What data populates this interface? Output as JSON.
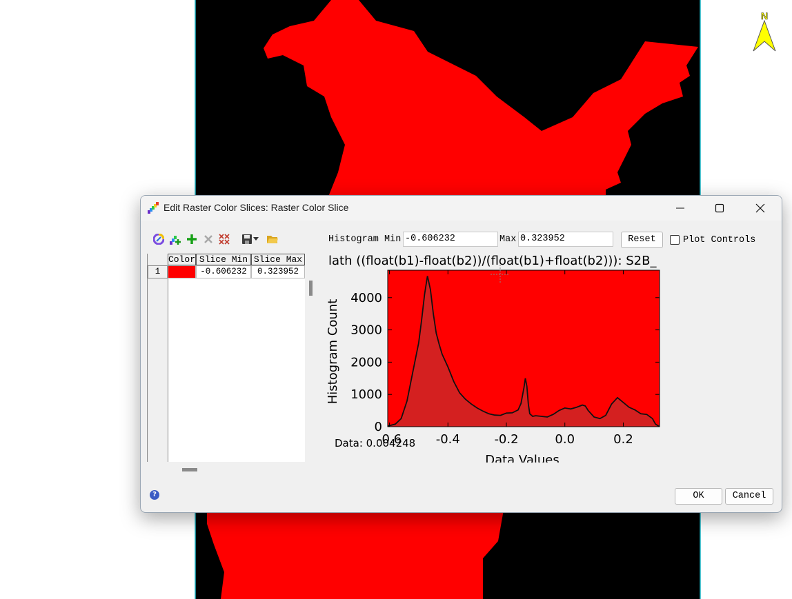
{
  "colors": {
    "background_black": "#000000",
    "region_red": "#ff0000",
    "hist_fill": "#d42020",
    "plot_bg": "#ff0000",
    "north_arrow": "#ffff00",
    "help_icon": "#3b5cc4"
  },
  "map": {
    "north_label": "N"
  },
  "dialog": {
    "title": "Edit Raster Color Slices: Raster Color Slice",
    "window_controls": [
      "minimize-icon",
      "maximize-icon",
      "close-icon"
    ],
    "toolbar_icons": [
      "color-wheel-icon",
      "auto-slice-icon",
      "add-icon",
      "delete-icon",
      "delete-all-icon",
      "save-icon",
      "save-dropdown-icon",
      "open-folder-icon"
    ],
    "table": {
      "headers": [
        "Color",
        "Slice Min",
        "Slice Max"
      ],
      "rows": [
        {
          "index": "1",
          "color": "#ff0000",
          "min": "-0.606232",
          "max": "0.323952"
        }
      ]
    },
    "histogram": {
      "min_label": "Histogram Min",
      "min_value": "-0.606232",
      "max_label": "Max",
      "max_value": "0.323952",
      "reset_label": "Reset",
      "plot_controls_label": "Plot Controls",
      "plot_controls_checked": false,
      "cursor_readout": "Data: 0.004248"
    },
    "ok_label": "OK",
    "cancel_label": "Cancel"
  },
  "chart_data": {
    "type": "area",
    "title": "lath ((float(b1)-float(b2))/(float(b1)+float(b2))): S2B_",
    "xlabel": "Data Values",
    "ylabel": "Histogram Count",
    "xlim": [
      -0.606,
      0.324
    ],
    "ylim": [
      0,
      4850
    ],
    "x_ticks": [
      -0.6,
      -0.4,
      -0.2,
      0.0,
      0.2
    ],
    "x_tick_labels": [
      "-0.6",
      "-0.4",
      "-0.2",
      "0.0",
      "0.2"
    ],
    "y_ticks": [
      0,
      1000,
      2000,
      3000,
      4000
    ],
    "y_tick_labels": [
      "0",
      "1000",
      "2000",
      "3000",
      "4000"
    ],
    "grid": false,
    "series": [
      {
        "x": [
          -0.606,
          -0.58,
          -0.56,
          -0.54,
          -0.52,
          -0.5,
          -0.49,
          -0.48,
          -0.47,
          -0.46,
          -0.45,
          -0.44,
          -0.43,
          -0.42,
          -0.4,
          -0.38,
          -0.36,
          -0.34,
          -0.32,
          -0.3,
          -0.28,
          -0.26,
          -0.24,
          -0.22,
          -0.2,
          -0.18,
          -0.16,
          -0.15,
          -0.14,
          -0.135,
          -0.13,
          -0.125,
          -0.12,
          -0.11,
          -0.1,
          -0.08,
          -0.06,
          -0.04,
          -0.02,
          0.0,
          0.02,
          0.04,
          0.06,
          0.07,
          0.08,
          0.1,
          0.12,
          0.14,
          0.16,
          0.18,
          0.2,
          0.22,
          0.24,
          0.26,
          0.28,
          0.3,
          0.31,
          0.324
        ],
        "values": [
          20,
          80,
          250,
          800,
          1700,
          2600,
          3300,
          4100,
          4670,
          4250,
          3500,
          2900,
          2550,
          2250,
          1850,
          1400,
          1050,
          850,
          700,
          580,
          480,
          400,
          360,
          350,
          420,
          430,
          520,
          720,
          1200,
          1500,
          1250,
          700,
          400,
          320,
          340,
          320,
          300,
          380,
          500,
          580,
          550,
          600,
          670,
          640,
          500,
          300,
          250,
          350,
          700,
          900,
          750,
          600,
          520,
          400,
          380,
          250,
          80,
          0
        ]
      }
    ]
  }
}
